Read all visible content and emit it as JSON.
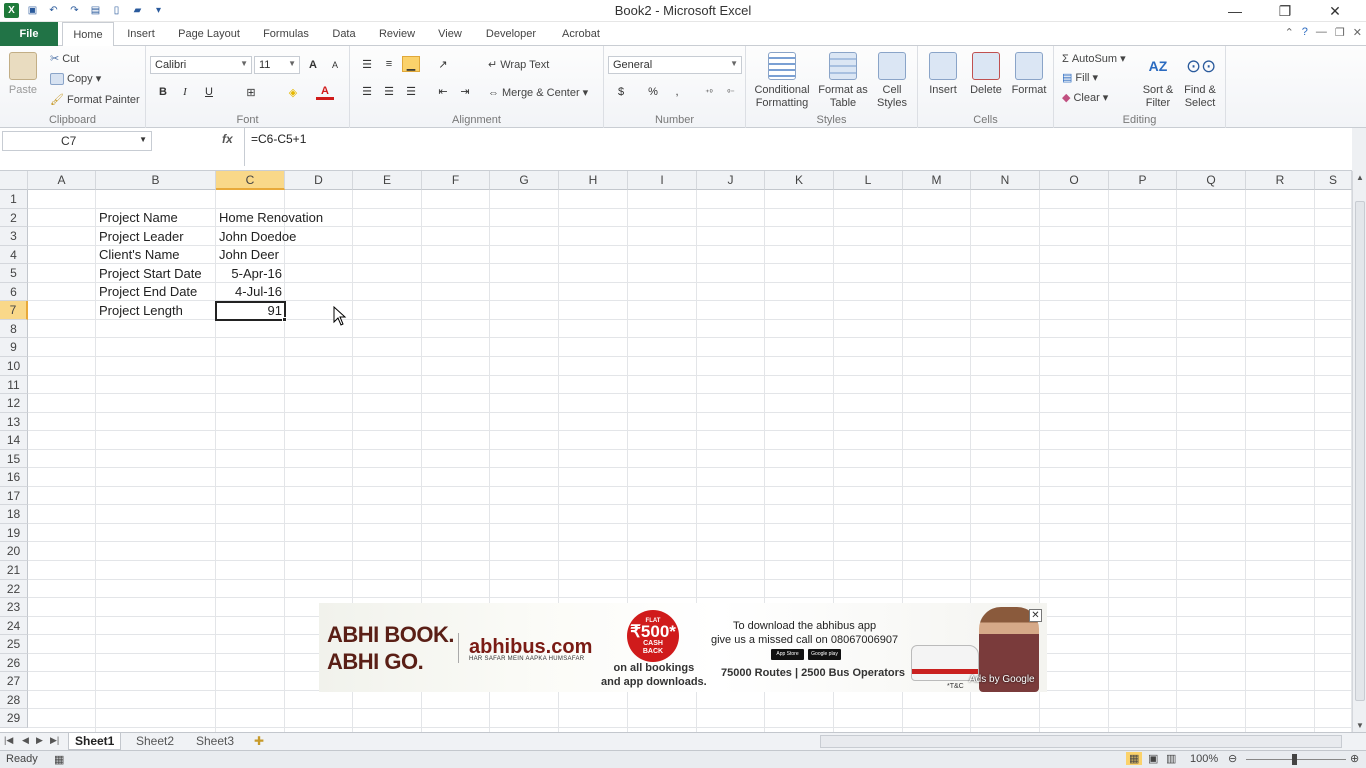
{
  "window": {
    "title": "Book2 - Microsoft Excel",
    "minimize": "—",
    "restore": "❐",
    "close": "✕"
  },
  "qat": {
    "logo": "X",
    "save": "💾",
    "undo": "↶",
    "redo": "↷"
  },
  "tabs": [
    "File",
    "Home",
    "Insert",
    "Page Layout",
    "Formulas",
    "Data",
    "Review",
    "View",
    "Developer",
    "Acrobat"
  ],
  "ribbon": {
    "clipboard": {
      "paste": "Paste",
      "cut": "Cut",
      "copy": "Copy",
      "format_painter": "Format Painter",
      "label": "Clipboard"
    },
    "font": {
      "name": "Calibri",
      "size": "11",
      "bold": "B",
      "italic": "I",
      "underline": "U",
      "grow": "A",
      "shrink": "A",
      "color_letter": "A",
      "label": "Font"
    },
    "alignment": {
      "wrap": "Wrap Text",
      "merge": "Merge & Center",
      "label": "Alignment"
    },
    "number": {
      "format": "General",
      "currency": "$",
      "percent": "%",
      "comma": ",",
      "label": "Number"
    },
    "styles": {
      "conditional": "Conditional Formatting",
      "format_table": "Format as Table",
      "cell_styles": "Cell Styles",
      "label": "Styles"
    },
    "cells": {
      "insert": "Insert",
      "delete": "Delete",
      "format": "Format",
      "label": "Cells"
    },
    "editing": {
      "autosum": "AutoSum",
      "fill": "Fill",
      "clear": "Clear",
      "sort": "Sort & Filter",
      "find": "Find & Select",
      "label": "Editing"
    }
  },
  "formula_bar": {
    "name_box": "C7",
    "fx": "fx",
    "formula": "=C6-C5+1"
  },
  "columns": [
    "A",
    "B",
    "C",
    "D",
    "E",
    "F",
    "G",
    "H",
    "I",
    "J",
    "K",
    "L",
    "M",
    "N",
    "O",
    "P",
    "Q",
    "R",
    "S"
  ],
  "rows": [
    "1",
    "2",
    "3",
    "4",
    "5",
    "6",
    "7",
    "8",
    "9",
    "10",
    "11",
    "12",
    "13",
    "14",
    "15",
    "16",
    "17",
    "18",
    "19",
    "20",
    "21",
    "22",
    "23",
    "24",
    "25",
    "26",
    "27",
    "28",
    "29"
  ],
  "cells": {
    "b2": "Project Name",
    "c2": "Home Renovation",
    "b3": "Project Leader",
    "c3": "John Doedoe",
    "b4": "Client's Name",
    "c4": "John Deer",
    "b5": "Project Start Date",
    "c5": "5-Apr-16",
    "b6": "Project End Date",
    "c6": "4-Jul-16",
    "b7": "Project Length",
    "c7": "91"
  },
  "sheets": [
    "Sheet1",
    "Sheet2",
    "Sheet3"
  ],
  "status": {
    "ready": "Ready",
    "zoom": "100%"
  },
  "ad": {
    "slogan1": "ABHI BOOK.",
    "slogan2": "ABHI GO.",
    "brand": "abhibus.com",
    "brand_sub": "HAR SAFAR MEIN AAPKA HUMSAFAR",
    "flat": "FLAT",
    "amount": "₹500*",
    "cashback1": "CASH",
    "cashback2": "BACK",
    "on_all": "on all bookings",
    "app_dl": "and app downloads.",
    "download1": "To download the abhibus app",
    "download2": "give us a missed call on 08067006907",
    "routes": "75000 Routes | 2500 Bus Operators",
    "tc": "*T&C",
    "ads_by": "Ads by Google",
    "close": "✕"
  }
}
